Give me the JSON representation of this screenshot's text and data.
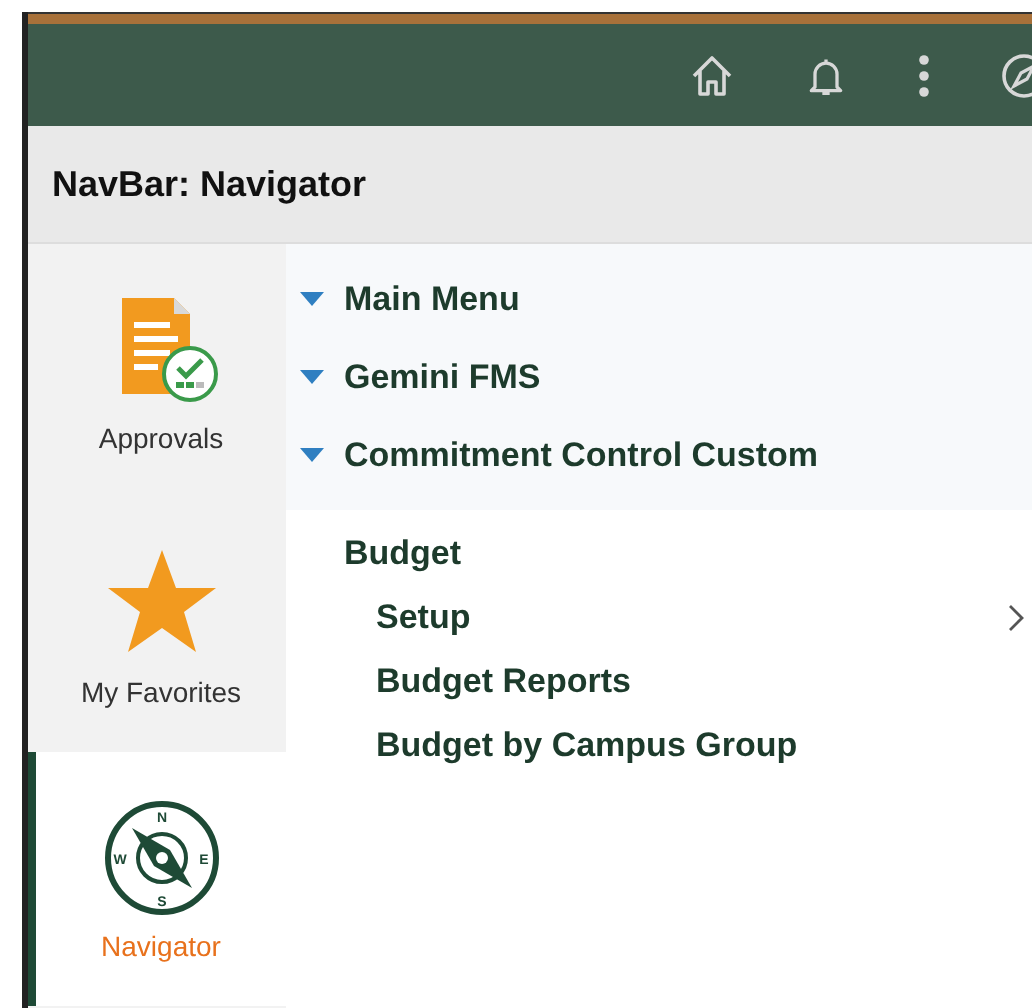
{
  "title": "NavBar: Navigator",
  "tiles": [
    {
      "kind": "approvals",
      "label": "Approvals",
      "selected": false
    },
    {
      "kind": "favorites",
      "label": "My Favorites",
      "selected": false
    },
    {
      "kind": "navigator",
      "label": "Navigator",
      "selected": true,
      "compass_letters": [
        "N",
        "S",
        "W",
        "E"
      ]
    }
  ],
  "breadcrumbs": [
    {
      "label": "Main Menu"
    },
    {
      "label": "Gemini FMS"
    },
    {
      "label": "Commitment Control Custom"
    }
  ],
  "folder": {
    "label": "Budget",
    "children": [
      {
        "label": "Setup",
        "has_children": true
      },
      {
        "label": "Budget Reports",
        "has_children": false
      },
      {
        "label": "Budget by Campus Group",
        "has_children": false
      }
    ]
  }
}
